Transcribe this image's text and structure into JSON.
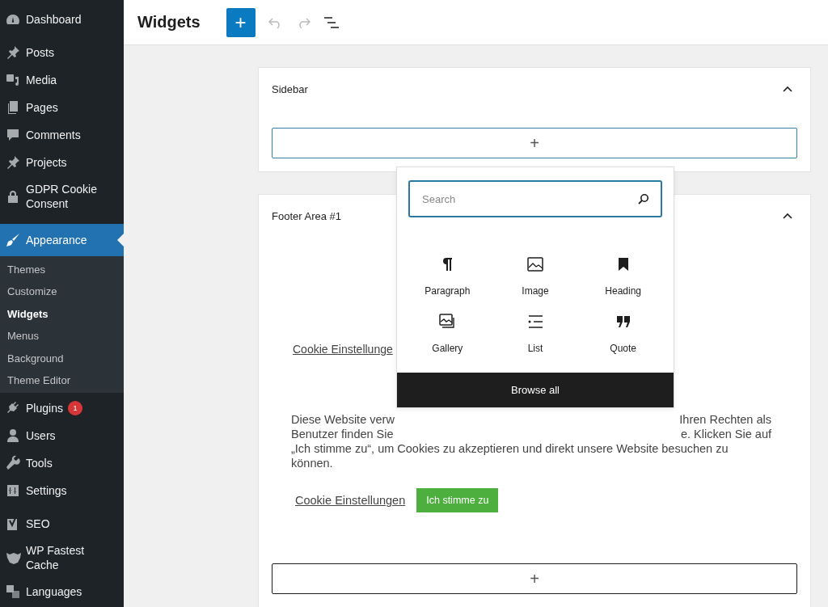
{
  "menu": [
    {
      "label": "Dashboard",
      "selected": false
    },
    {
      "label": "Posts",
      "selected": false
    },
    {
      "label": "Media",
      "selected": false
    },
    {
      "label": "Pages",
      "selected": false
    },
    {
      "label": "Comments",
      "selected": false
    },
    {
      "label": "Projects",
      "selected": false
    },
    {
      "label": "GDPR Cookie Consent",
      "selected": false
    },
    {
      "label": "Appearance",
      "selected": true,
      "children": [
        {
          "label": "Themes",
          "selected": false
        },
        {
          "label": "Customize",
          "selected": false
        },
        {
          "label": "Widgets",
          "selected": true
        },
        {
          "label": "Menus",
          "selected": false
        },
        {
          "label": "Background",
          "selected": false
        },
        {
          "label": "Theme Editor",
          "selected": false
        }
      ]
    },
    {
      "label": "Plugins",
      "selected": false,
      "badge": "1"
    },
    {
      "label": "Users",
      "selected": false
    },
    {
      "label": "Tools",
      "selected": false
    },
    {
      "label": "Settings",
      "selected": false
    },
    {
      "label": "SEO",
      "selected": false
    },
    {
      "label": "WP Fastest Cache",
      "selected": false
    },
    {
      "label": "Languages",
      "selected": false
    }
  ],
  "header": {
    "title": "Widgets",
    "add_button": "+"
  },
  "areas": [
    {
      "title": "Sidebar",
      "expanded": true,
      "appender": "+"
    },
    {
      "title": "Footer Area #1",
      "expanded": true,
      "link_top": "Cookie Einstellunge",
      "paragraph_lines": [
        {
          "left": "Diese Website verw",
          "right": "Ihren Rechten als"
        },
        {
          "left": "Benutzer finden Sie",
          "right": "e. Klicken Sie auf"
        },
        {
          "left": "„Ich stimme zu“, um Cookies zu akzeptieren und direkt unsere Website besuchen zu"
        },
        {
          "left": "können."
        }
      ],
      "link": "Cookie Einstellungen",
      "accept_button": "Ich stimme zu",
      "appender": "+"
    }
  ],
  "inserter": {
    "search": {
      "placeholder": "Search"
    },
    "blocks": [
      {
        "label": "Paragraph"
      },
      {
        "label": "Image"
      },
      {
        "label": "Heading"
      },
      {
        "label": "Gallery"
      },
      {
        "label": "List"
      },
      {
        "label": "Quote"
      }
    ],
    "browse_all": "Browse all"
  }
}
